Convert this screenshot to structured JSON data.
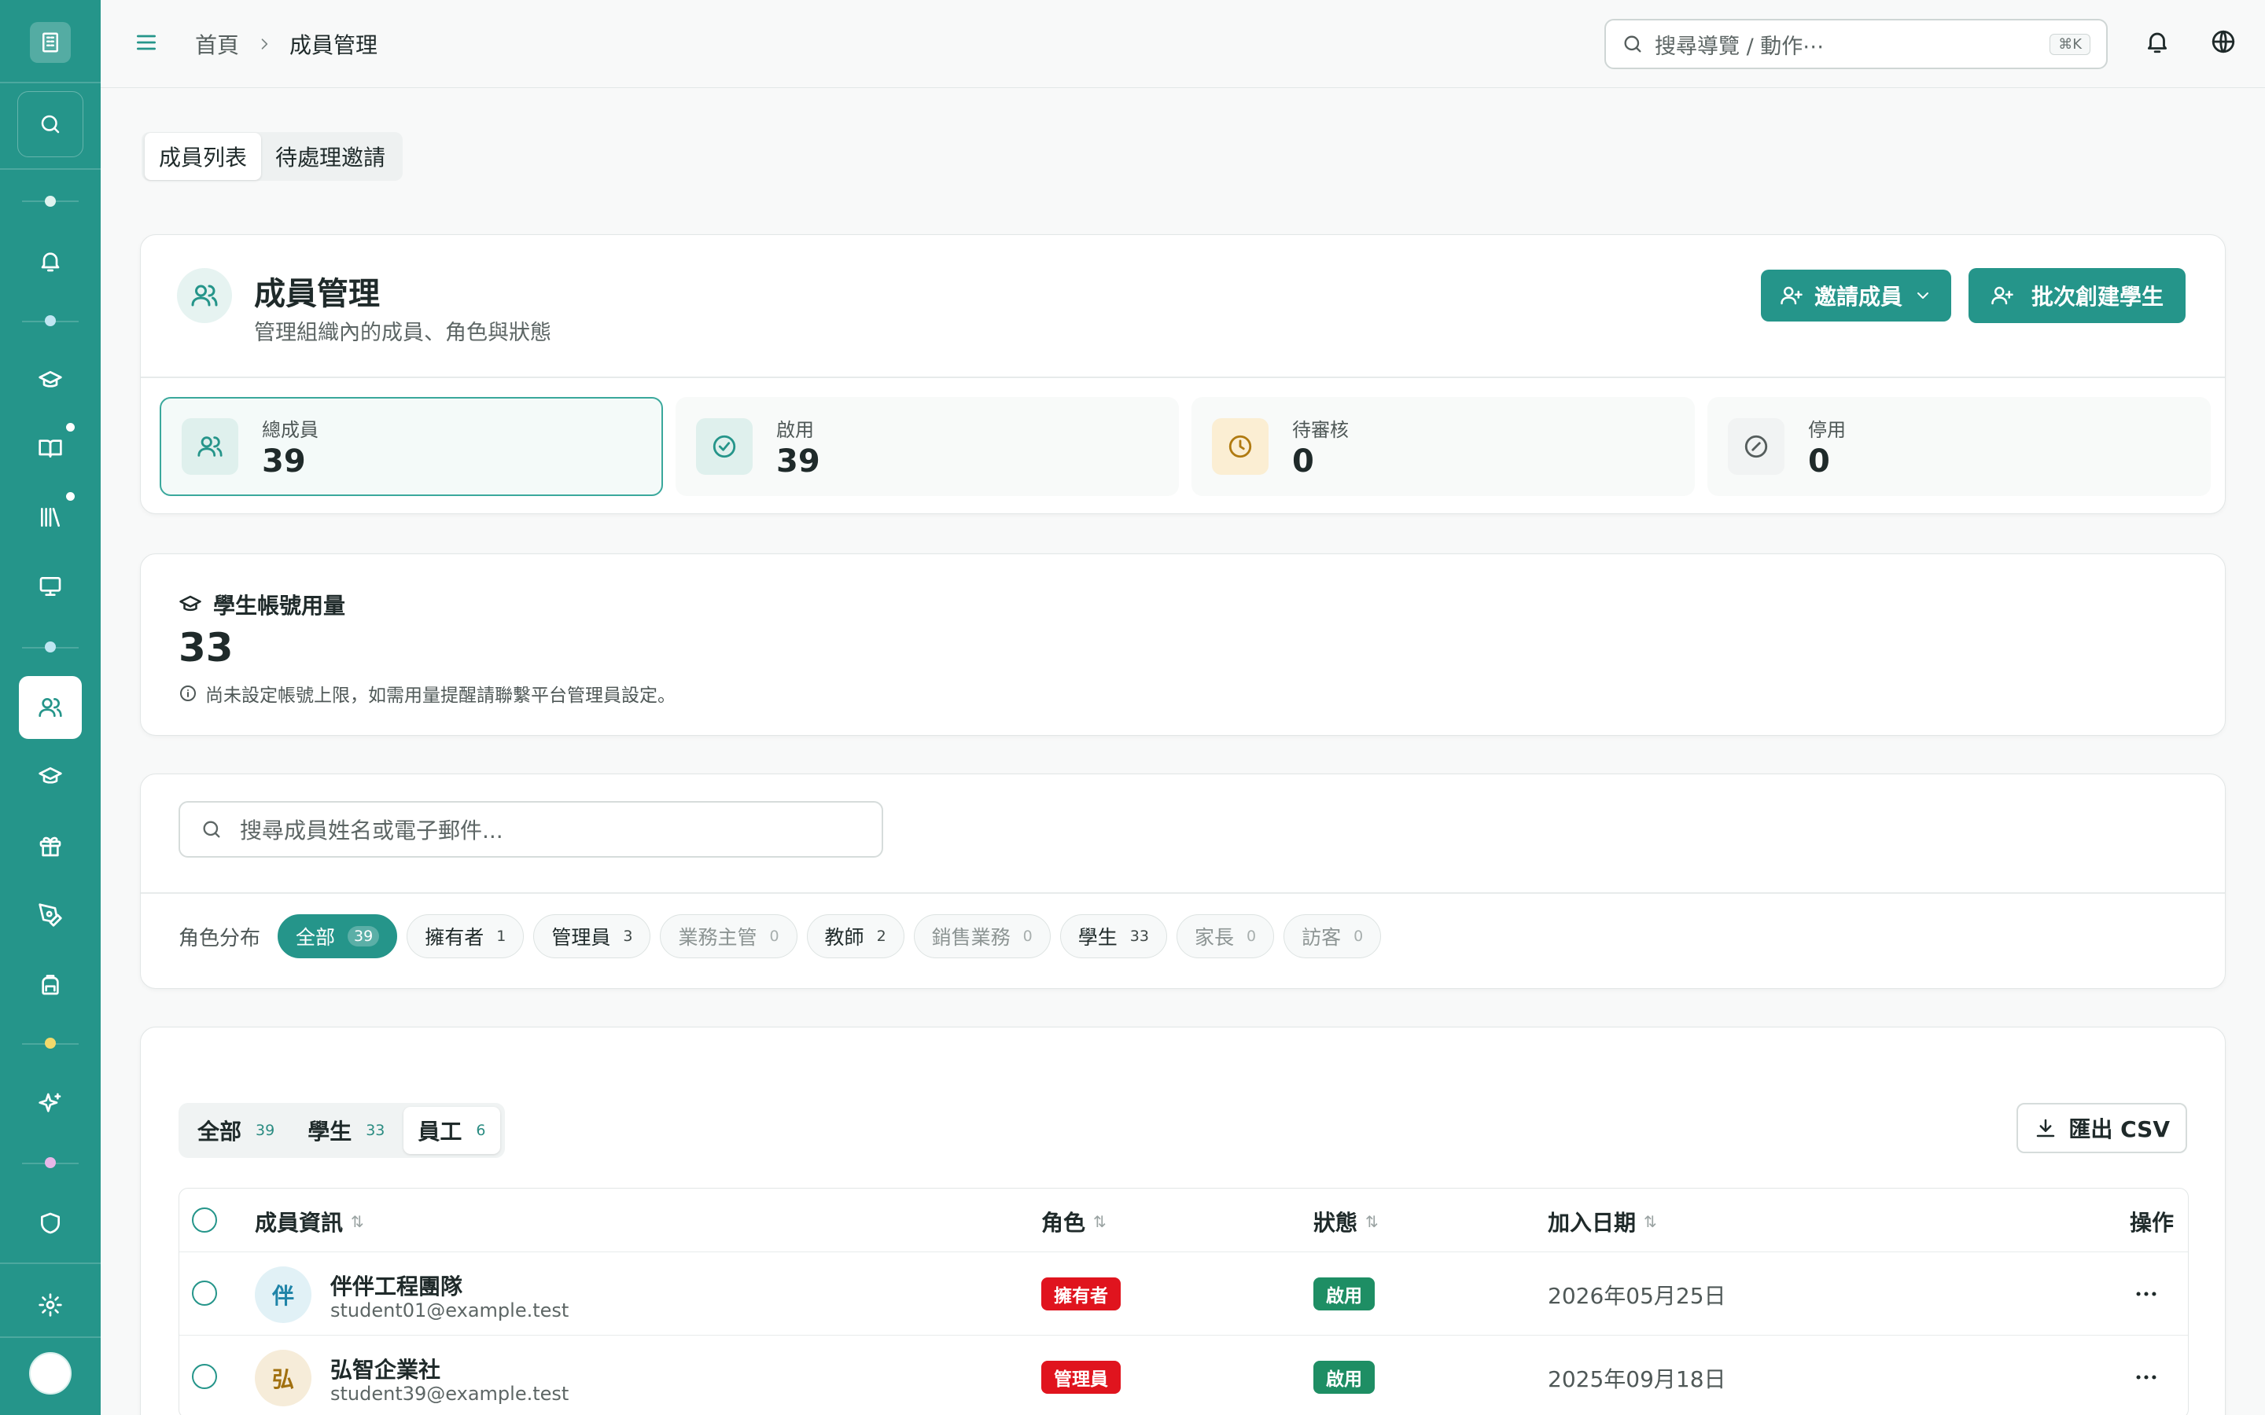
{
  "topbar": {
    "breadcrumb_home": "首頁",
    "breadcrumb_current": "成員管理",
    "search_placeholder": "搜尋導覽 / 動作⋯",
    "search_shortcut": "⌘K"
  },
  "tabs": [
    {
      "label": "成員列表",
      "active": true
    },
    {
      "label": "待處理邀請",
      "active": false
    }
  ],
  "header": {
    "title": "成員管理",
    "subtitle": "管理組織內的成員、角色與狀態",
    "invite_label": "邀請成員",
    "batch_label": "批次創建學生"
  },
  "stats": [
    {
      "label": "總成員",
      "value": "39",
      "icon": "users-icon",
      "color": "#25958a"
    },
    {
      "label": "啟用",
      "value": "39",
      "icon": "check-circle-icon",
      "color": "#25958a"
    },
    {
      "label": "待審核",
      "value": "0",
      "icon": "clock-icon",
      "color": "#b07a10"
    },
    {
      "label": "停用",
      "value": "0",
      "icon": "ban-icon",
      "color": "#555d5c"
    }
  ],
  "usage": {
    "title": "學生帳號用量",
    "value": "33",
    "note": "尚未設定帳號上限，如需用量提醒請聯繫平台管理員設定。"
  },
  "filter": {
    "search_placeholder": "搜尋成員姓名或電子郵件...",
    "roles_label": "角色分布",
    "chips": [
      {
        "label": "全部",
        "count": "39"
      },
      {
        "label": "擁有者",
        "count": "1"
      },
      {
        "label": "管理員",
        "count": "3"
      },
      {
        "label": "業務主管",
        "count": "0"
      },
      {
        "label": "教師",
        "count": "2"
      },
      {
        "label": "銷售業務",
        "count": "0"
      },
      {
        "label": "學生",
        "count": "33"
      },
      {
        "label": "家長",
        "count": "0"
      },
      {
        "label": "訪客",
        "count": "0"
      }
    ]
  },
  "list": {
    "segments": [
      {
        "label": "全部",
        "count": "39"
      },
      {
        "label": "學生",
        "count": "33"
      },
      {
        "label": "員工",
        "count": "6"
      }
    ],
    "export_label": "匯出 CSV",
    "columns": {
      "info": "成員資訊",
      "role": "角色",
      "status": "狀態",
      "joined": "加入日期",
      "actions": "操作"
    },
    "rows": [
      {
        "avatar": "伴",
        "name": "伴伴工程團隊",
        "email": "student01@example.test",
        "role": "擁有者",
        "status": "啟用",
        "joined": "2026年05月25日"
      },
      {
        "avatar": "弘",
        "name": "弘智企業社",
        "email": "student39@example.test",
        "role": "管理員",
        "status": "啟用",
        "joined": "2025年09月18日"
      }
    ]
  },
  "colors": {
    "brand": "#25958a",
    "danger": "#e0141e",
    "success": "#1e8e64"
  }
}
